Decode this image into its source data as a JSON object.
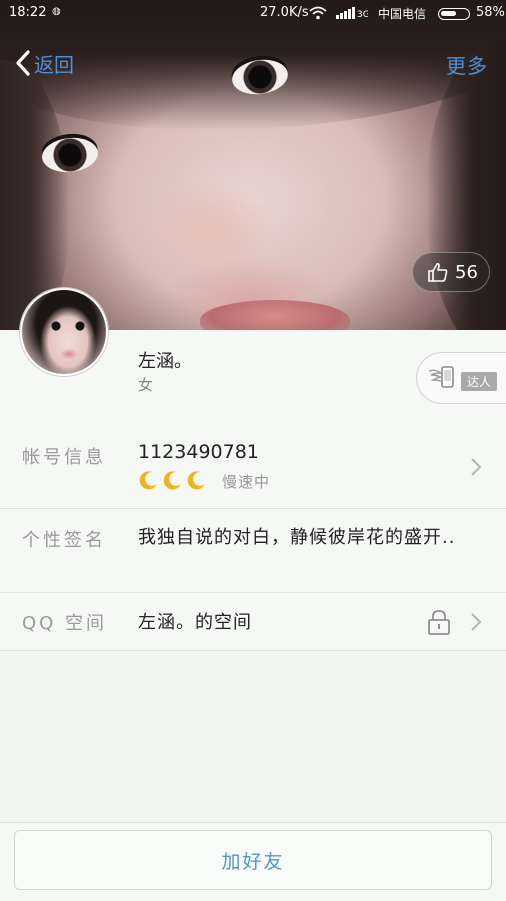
{
  "status_bar": {
    "time": "18:22",
    "speed": "27.0K/s",
    "carrier": "中国电信",
    "battery": "58%"
  },
  "nav": {
    "back_label": "返回",
    "more_label": "更多"
  },
  "likes": {
    "count": "56"
  },
  "profile": {
    "name": "左涵。",
    "gender": "女",
    "badge_label": "达人"
  },
  "account": {
    "label": "帐号信息",
    "qq_number": "1123490781",
    "speed_status": "慢速中"
  },
  "signature": {
    "label": "个性签名",
    "text": "我独自说的对白，静候彼岸花的盛开.."
  },
  "qzone": {
    "label": "QQ 空间",
    "value": "左涵。的空间"
  },
  "actions": {
    "add_friend_label": "加好友"
  },
  "colors": {
    "accent_blue": "#4e97d6",
    "moon_yellow": "#f1b21c"
  }
}
